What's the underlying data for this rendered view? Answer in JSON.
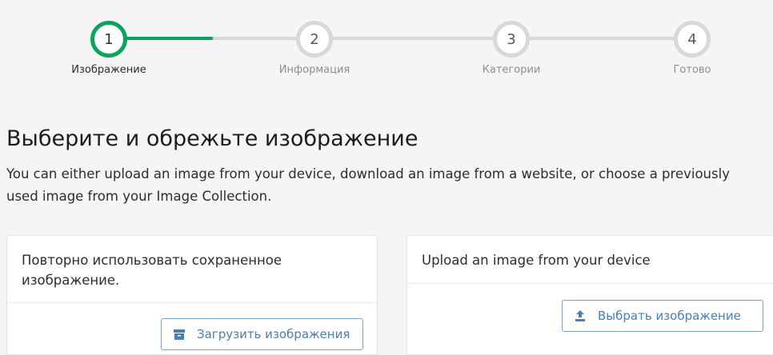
{
  "steps": [
    {
      "number": "1",
      "label": "Изображение",
      "active": true
    },
    {
      "number": "2",
      "label": "Информация",
      "active": false
    },
    {
      "number": "3",
      "label": "Категории",
      "active": false
    },
    {
      "number": "4",
      "label": "Готово",
      "active": false
    }
  ],
  "colors": {
    "accent": "#0aa45c",
    "link": "#4a7fb3"
  },
  "page": {
    "title": "Выберите и обрежьте изображение",
    "subtitle": "You can either upload an image from your device, download an image from a website, or choose a previously used image from your Image Collection."
  },
  "cards": {
    "reuse": {
      "heading": "Повторно использовать сохраненное изображение.",
      "button_label": "Загрузить изображения",
      "button_icon": "archive-box-icon"
    },
    "upload": {
      "heading": "Upload an image from your device",
      "button_label": "Выбрать изображение",
      "button_icon": "upload-icon"
    }
  }
}
